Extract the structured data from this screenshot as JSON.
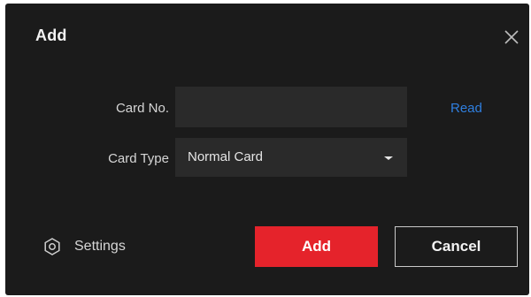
{
  "dialog": {
    "title": "Add",
    "close_icon": "close-icon"
  },
  "form": {
    "card_no": {
      "label": "Card No.",
      "value": "",
      "placeholder": ""
    },
    "read_link": "Read",
    "card_type": {
      "label": "Card Type",
      "selected": "Normal Card"
    }
  },
  "footer": {
    "settings_label": "Settings",
    "settings_icon": "gear-icon",
    "add_label": "Add",
    "cancel_label": "Cancel"
  },
  "colors": {
    "background": "#1b1b1b",
    "accent_red": "#e5232b",
    "link_blue": "#2f7fe0"
  }
}
